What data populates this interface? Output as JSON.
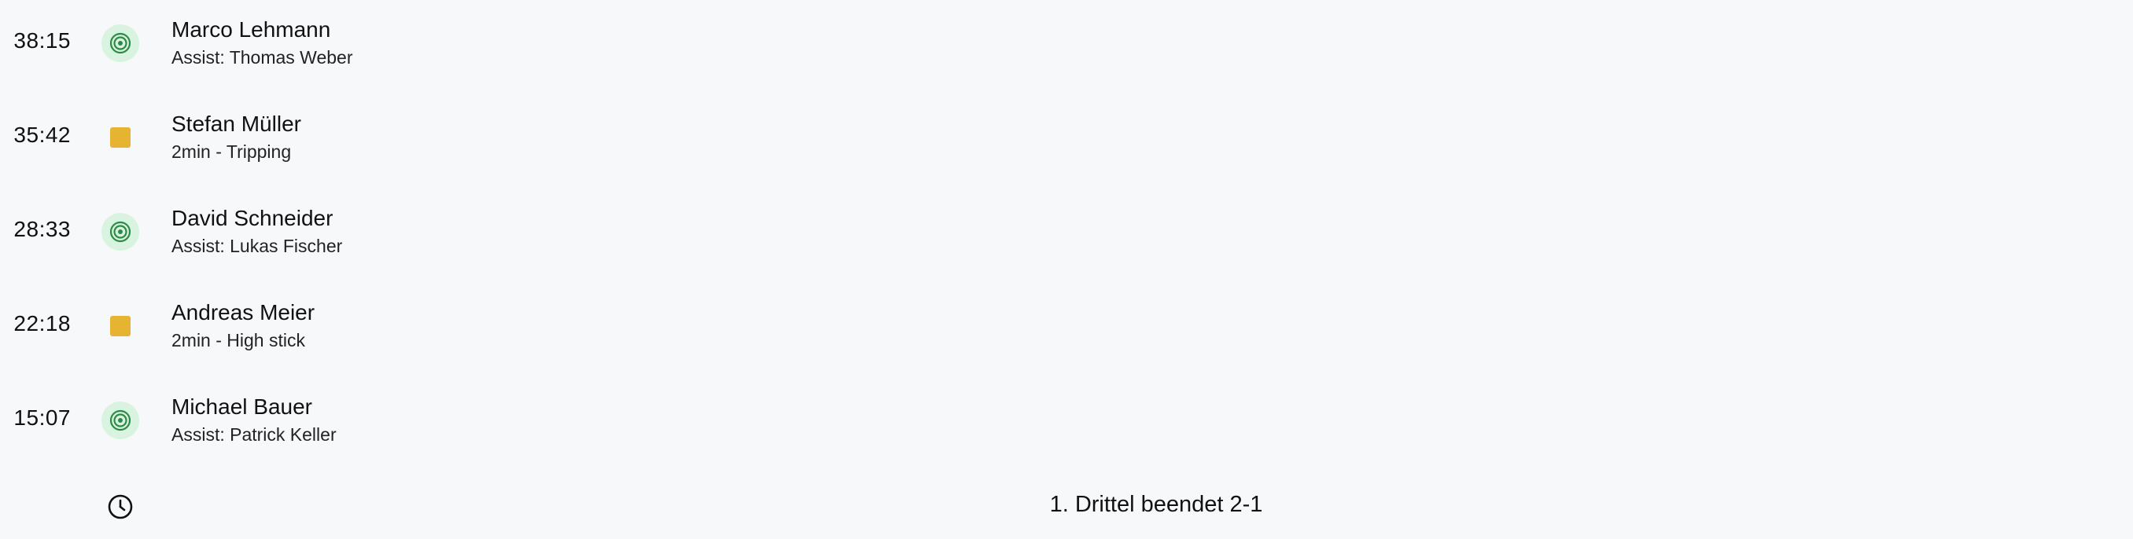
{
  "events": [
    {
      "time": "38:15",
      "type": "goal",
      "icon": "goal-target-icon",
      "player": "Marco Lehmann",
      "detail": "Assist: Thomas Weber"
    },
    {
      "time": "35:42",
      "type": "penalty",
      "icon": "penalty-square-icon",
      "player": "Stefan Müller",
      "detail": "2min - Tripping"
    },
    {
      "time": "28:33",
      "type": "goal",
      "icon": "goal-target-icon",
      "player": "David Schneider",
      "detail": "Assist: Lukas Fischer"
    },
    {
      "time": "22:18",
      "type": "penalty",
      "icon": "penalty-square-icon",
      "player": "Andreas Meier",
      "detail": "2min - High stick"
    },
    {
      "time": "15:07",
      "type": "goal",
      "icon": "goal-target-icon",
      "player": "Michael Bauer",
      "detail": "Assist: Patrick Keller"
    }
  ],
  "period_end": {
    "icon": "clock-icon",
    "label": "1. Drittel beendet 2-1"
  },
  "colors": {
    "background": "#f7f8fa",
    "goal_badge_bg": "#d8f3df",
    "goal_badge_fg": "#2e8b46",
    "penalty": "#e6b333"
  }
}
